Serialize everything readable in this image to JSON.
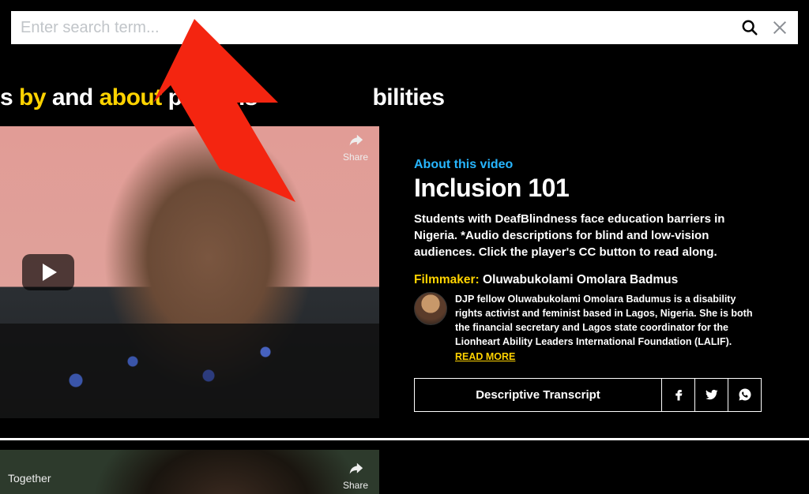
{
  "search": {
    "placeholder": "Enter search term..."
  },
  "headline": {
    "prefix": "s ",
    "word1": "by",
    "word2": "and",
    "word3": "about",
    "rest_1": "persons",
    "rest_2": "bilities"
  },
  "video1": {
    "share_label": "Share"
  },
  "meta": {
    "about_label": "About this video",
    "title": "Inclusion 101",
    "description": "Students with DeafBlindness face education barriers in Nigeria. *Audio descriptions for blind and low-vision audiences. Click the player's CC button to read along.",
    "filmmaker_label": "Filmmaker:",
    "filmmaker_name": "Oluwabukolami Omolara Badmus",
    "bio": "DJP fellow Oluwabukolami Omolara Badumus is a disability rights activist and feminist based in Lagos, Nigeria. She is both the financial secretary and Lagos state coordinator for the Lionheart Ability Leaders International Foundation (LALIF).  ",
    "read_more": "READ MORE",
    "transcript_button": "Descriptive Transcript"
  },
  "video2": {
    "overlay_text": "Together",
    "share_label": "Share"
  }
}
